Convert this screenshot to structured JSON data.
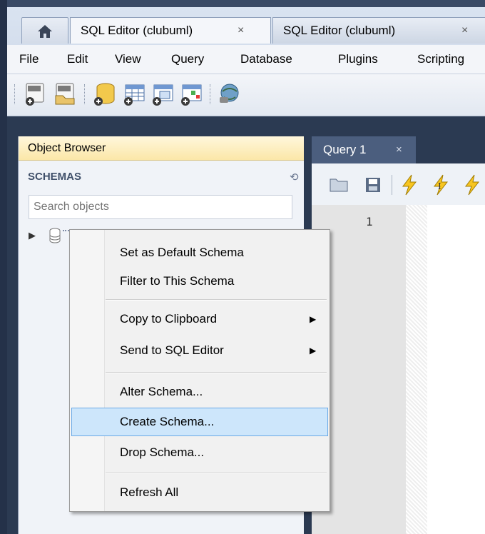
{
  "tabs": [
    {
      "label": "SQL Editor (clubuml)",
      "close": "×",
      "active": true
    },
    {
      "label": "SQL Editor (clubuml)",
      "close": "×",
      "active": false
    }
  ],
  "menu": [
    "File",
    "Edit",
    "View",
    "Query",
    "Database",
    "Plugins",
    "Scripting"
  ],
  "object_browser": {
    "title": "Object Browser",
    "schemas_label": "SCHEMAS",
    "search_placeholder": "Search objects"
  },
  "editor": {
    "tab_label": "Query 1",
    "tab_close": "×",
    "line_number": "1"
  },
  "context_menu": {
    "items": [
      {
        "label": "Set as Default Schema"
      },
      {
        "label": "Filter to This Schema"
      },
      {
        "label": "Copy to Clipboard",
        "submenu": true
      },
      {
        "label": "Send to SQL Editor",
        "submenu": true
      },
      {
        "label": "Alter Schema..."
      },
      {
        "label": "Create Schema...",
        "highlighted": true
      },
      {
        "label": "Drop Schema..."
      },
      {
        "label": "Refresh All"
      }
    ],
    "submenu_glyph": "▶"
  },
  "colors": {
    "frame": "#2b3a52",
    "panel_header": "#fbe7a8",
    "highlight_bg": "#cde6fb",
    "highlight_border": "#6aa9e6",
    "editor_tab": "#4b5e7e"
  }
}
